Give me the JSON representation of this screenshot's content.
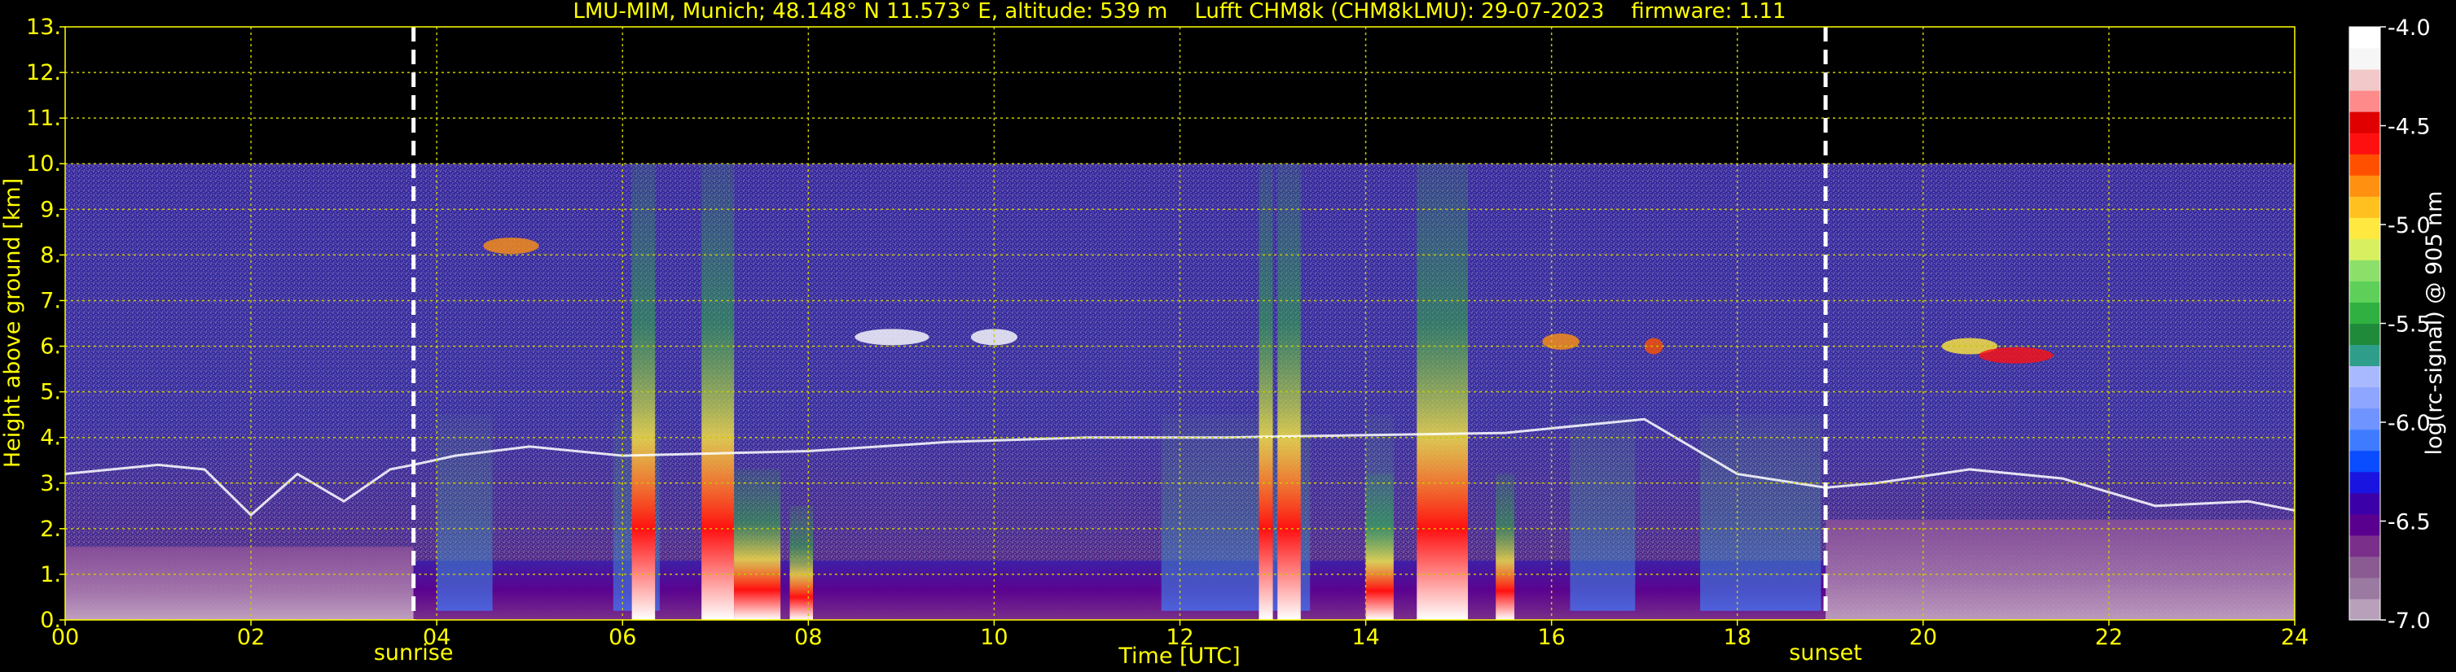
{
  "chart_data": {
    "type": "heatmap",
    "title": "LMU-MIM, Munich; 48.148° N 11.573° E, altitude: 539 m    Lufft CHM8k (CHM8kLMU): 29-07-2023    firmware: 1.11",
    "xlabel": "Time [UTC]",
    "ylabel": "Height above ground [km]",
    "xlim": [
      0,
      24
    ],
    "ylim": [
      0,
      13
    ],
    "x_ticks": [
      "00",
      "02",
      "04",
      "06",
      "08",
      "10",
      "12",
      "14",
      "16",
      "18",
      "20",
      "22",
      "24"
    ],
    "y_ticks": [
      "0.",
      "1.",
      "2.",
      "3.",
      "4.",
      "5.",
      "6.",
      "7.",
      "8.",
      "9.",
      "10.",
      "11.",
      "12.",
      "13."
    ],
    "grid": true,
    "measurement_top_km": 10,
    "annotations": [
      {
        "label": "sunrise",
        "x": 3.75
      },
      {
        "label": "sunset",
        "x": 18.95
      }
    ],
    "colorbar": {
      "label": "log(rc-signal) @ 905 nm",
      "range": [
        -7.0,
        -4.0
      ],
      "ticks": [
        "-4.0",
        "-4.5",
        "-5.0",
        "-5.5",
        "-6.0",
        "-6.5",
        "-7.0"
      ],
      "colors_bottom_to_top": [
        "#b8a0bb",
        "#9a7aa0",
        "#8a5a92",
        "#7a2f8a",
        "#5a008f",
        "#3c00a8",
        "#1a14e0",
        "#0a4cff",
        "#3f7bff",
        "#6f94ff",
        "#8ea6ff",
        "#a9b9ff",
        "#2e9e8a",
        "#1f8a3a",
        "#2fb040",
        "#5ed05a",
        "#8ce06a",
        "#d8f060",
        "#ffe840",
        "#ffc020",
        "#ff9010",
        "#ff5000",
        "#ff1010",
        "#e00000",
        "#ff8a8a",
        "#f2c8c8",
        "#f6f6f6",
        "#ffffff"
      ]
    },
    "features": [
      {
        "kind": "boundary_layer_top",
        "color": "#ffffff"
      },
      {
        "kind": "rain_streaks",
        "colors": [
          "#ff1010",
          "#ffe840",
          "#2fb040"
        ]
      },
      {
        "kind": "elevated_cloud",
        "color": "#ffffff"
      }
    ]
  }
}
